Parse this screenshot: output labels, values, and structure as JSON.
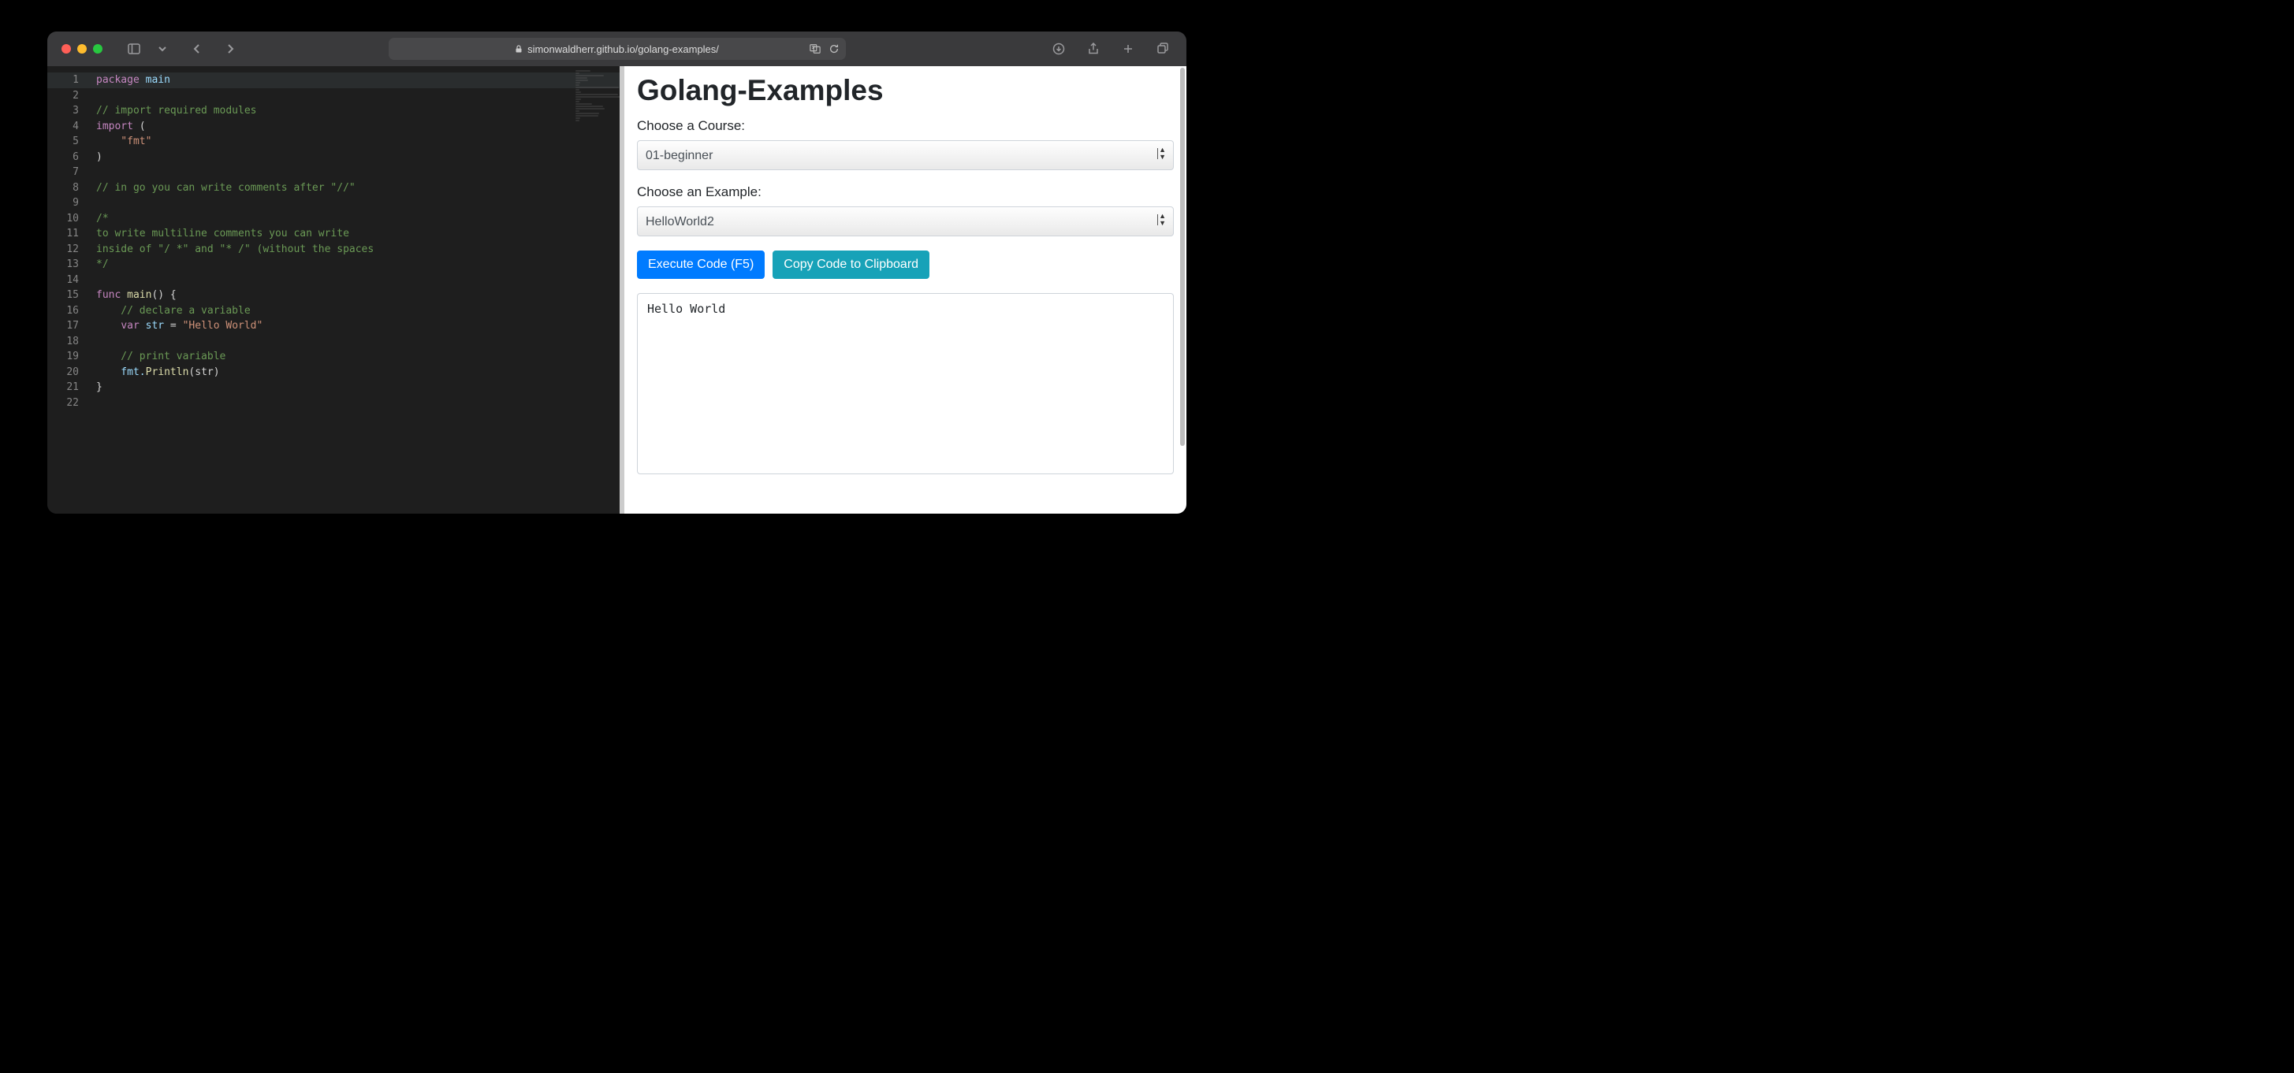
{
  "url": "simonwaldherr.github.io/golang-examples/",
  "editor": {
    "lines": [
      [
        {
          "t": "package ",
          "c": "kw"
        },
        {
          "t": "main",
          "c": "id"
        }
      ],
      [],
      [
        {
          "t": "// import required modules",
          "c": "cm"
        }
      ],
      [
        {
          "t": "import ",
          "c": "kw"
        },
        {
          "t": "(",
          "c": "op"
        }
      ],
      [
        {
          "t": "    \"fmt\"",
          "c": "st"
        }
      ],
      [
        {
          "t": ")",
          "c": "op"
        }
      ],
      [],
      [
        {
          "t": "// in go you can write comments after \"//\"",
          "c": "cm"
        }
      ],
      [],
      [
        {
          "t": "/*",
          "c": "cm"
        }
      ],
      [
        {
          "t": "to write multiline comments you can write",
          "c": "cm"
        }
      ],
      [
        {
          "t": "inside of \"/ *\" and \"* /\" (without the spaces",
          "c": "cm"
        }
      ],
      [
        {
          "t": "*/",
          "c": "cm"
        }
      ],
      [],
      [
        {
          "t": "func ",
          "c": "kw"
        },
        {
          "t": "main",
          "c": "fn"
        },
        {
          "t": "() {",
          "c": "op"
        }
      ],
      [
        {
          "t": "    // declare a variable",
          "c": "cm"
        }
      ],
      [
        {
          "t": "    ",
          "c": "op"
        },
        {
          "t": "var ",
          "c": "kw"
        },
        {
          "t": "str",
          "c": "id"
        },
        {
          "t": " = ",
          "c": "op"
        },
        {
          "t": "\"Hello World\"",
          "c": "st"
        }
      ],
      [],
      [
        {
          "t": "    // print variable",
          "c": "cm"
        }
      ],
      [
        {
          "t": "    fmt.",
          "c": "id"
        },
        {
          "t": "Println",
          "c": "fn"
        },
        {
          "t": "(str)",
          "c": "op"
        }
      ],
      [
        {
          "t": "}",
          "c": "op"
        }
      ],
      []
    ]
  },
  "panel": {
    "title": "Golang-Examples",
    "course_label": "Choose a Course:",
    "course_value": "01-beginner",
    "example_label": "Choose an Example:",
    "example_value": "HelloWorld2",
    "exec_btn": "Execute Code (F5)",
    "copy_btn": "Copy Code to Clipboard",
    "output": "Hello World"
  }
}
